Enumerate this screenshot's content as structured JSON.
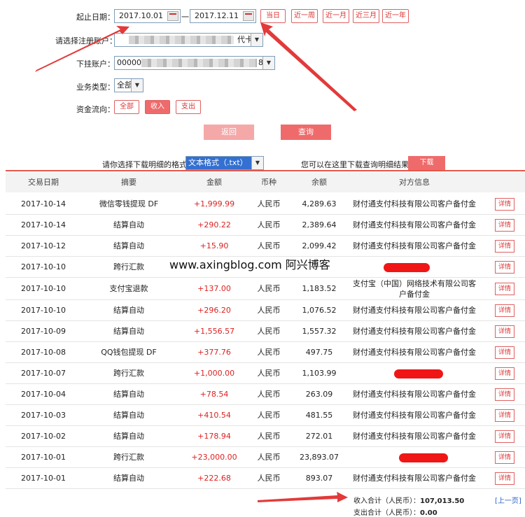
{
  "form": {
    "date_label": "起止日期：",
    "start_date": "2017.10.01",
    "end_date": "2017.12.11",
    "date_sep": "一",
    "quick_ranges": [
      "当日",
      "近一周",
      "近一月",
      "近三月",
      "近一年"
    ],
    "account_label": "请选择注册账户：",
    "account_suffix": "代卡",
    "sub_account_label": "下挂账户：",
    "sub_account_prefix": "00000",
    "sub_account_suffix": "8",
    "biz_type_label": "业务类型：",
    "biz_type_value": "全部",
    "flow_label": "资金流向：",
    "flow_options": [
      "全部",
      "收入",
      "支出"
    ],
    "flow_selected": "收入",
    "reset_label": "返回",
    "query_label": "查询"
  },
  "download": {
    "format_label": "请你选择下载明细的格式",
    "format_value": "文本格式（.txt）",
    "hint": "您可以在这里下载查询明细结果",
    "button": "下载"
  },
  "table": {
    "headers": [
      "交易日期",
      "摘要",
      "金额",
      "币种",
      "余额",
      "对方信息"
    ],
    "detail_label": "详情",
    "rows": [
      {
        "date": "2017-10-14",
        "memo": "微信零钱提现 DF",
        "amount": "+1,999.99",
        "currency": "人民币",
        "balance": "4,289.63",
        "party": "财付通支付科技有限公司客户备付金"
      },
      {
        "date": "2017-10-14",
        "memo": "结算自动",
        "amount": "+290.22",
        "currency": "人民币",
        "balance": "2,389.64",
        "party": "财付通支付科技有限公司客户备付金"
      },
      {
        "date": "2017-10-12",
        "memo": "结算自动",
        "amount": "+15.90",
        "currency": "人民币",
        "balance": "2,099.42",
        "party": "财付通支付科技有限公司客户备付金"
      },
      {
        "date": "2017-10-10",
        "memo": "跨行汇款",
        "amount": "",
        "currency": "",
        "balance": "",
        "party": ""
      },
      {
        "date": "2017-10-10",
        "memo": "支付宝退款",
        "amount": "+137.00",
        "currency": "人民币",
        "balance": "1,183.52",
        "party": "支付宝（中国）网络技术有限公司客户备付金"
      },
      {
        "date": "2017-10-10",
        "memo": "结算自动",
        "amount": "+296.20",
        "currency": "人民币",
        "balance": "1,076.52",
        "party": "财付通支付科技有限公司客户备付金"
      },
      {
        "date": "2017-10-09",
        "memo": "结算自动",
        "amount": "+1,556.57",
        "currency": "人民币",
        "balance": "1,557.32",
        "party": "财付通支付科技有限公司客户备付金"
      },
      {
        "date": "2017-10-08",
        "memo": "QQ钱包提现 DF",
        "amount": "+377.76",
        "currency": "人民币",
        "balance": "497.75",
        "party": "财付通支付科技有限公司客户备付金"
      },
      {
        "date": "2017-10-07",
        "memo": "跨行汇款",
        "amount": "+1,000.00",
        "currency": "人民币",
        "balance": "1,103.99",
        "party": ""
      },
      {
        "date": "2017-10-04",
        "memo": "结算自动",
        "amount": "+78.54",
        "currency": "人民币",
        "balance": "263.09",
        "party": "财付通支付科技有限公司客户备付金"
      },
      {
        "date": "2017-10-03",
        "memo": "结算自动",
        "amount": "+410.54",
        "currency": "人民币",
        "balance": "481.55",
        "party": "财付通支付科技有限公司客户备付金"
      },
      {
        "date": "2017-10-02",
        "memo": "结算自动",
        "amount": "+178.94",
        "currency": "人民币",
        "balance": "272.01",
        "party": "财付通支付科技有限公司客户备付金"
      },
      {
        "date": "2017-10-01",
        "memo": "跨行汇款",
        "amount": "+23,000.00",
        "currency": "人民币",
        "balance": "23,893.07",
        "party": ""
      },
      {
        "date": "2017-10-01",
        "memo": "结算自动",
        "amount": "+222.68",
        "currency": "人民币",
        "balance": "893.07",
        "party": "财付通支付科技有限公司客户备付金"
      }
    ]
  },
  "watermark": "www.axingblog.com 阿兴博客",
  "summary": {
    "income_label": "收入合计（人民币）：",
    "income_value": "107,013.50",
    "expense_label": "支出合计（人民币）：",
    "expense_value": "0.00",
    "prev_page": "[上一页]"
  },
  "colors": {
    "accent": "#e8564a",
    "amount": "#dd2222",
    "redact": "#f01616"
  }
}
